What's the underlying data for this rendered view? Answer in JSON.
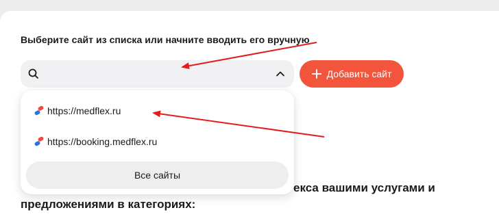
{
  "site_picker": {
    "prompt_label": "Выберите сайт из списка или начните вводить его вручную",
    "search_value": "",
    "add_button_label": "Добавить сайт",
    "dropdown": {
      "items": [
        {
          "label": "https://medflex.ru",
          "icon": "medflex-favicon-icon"
        },
        {
          "label": "https://booking.medflex.ru",
          "icon": "medflex-favicon-icon"
        }
      ],
      "all_sites_label": "Все сайты"
    }
  },
  "body_text": {
    "line1_visible": "екса вашими услугами и",
    "line2": "предложениями в категориях:"
  },
  "colors": {
    "accent": "#f2553c",
    "annotation_arrow": "#e21c1c",
    "field_background": "#f1f1f3",
    "page_background": "#ededed"
  }
}
